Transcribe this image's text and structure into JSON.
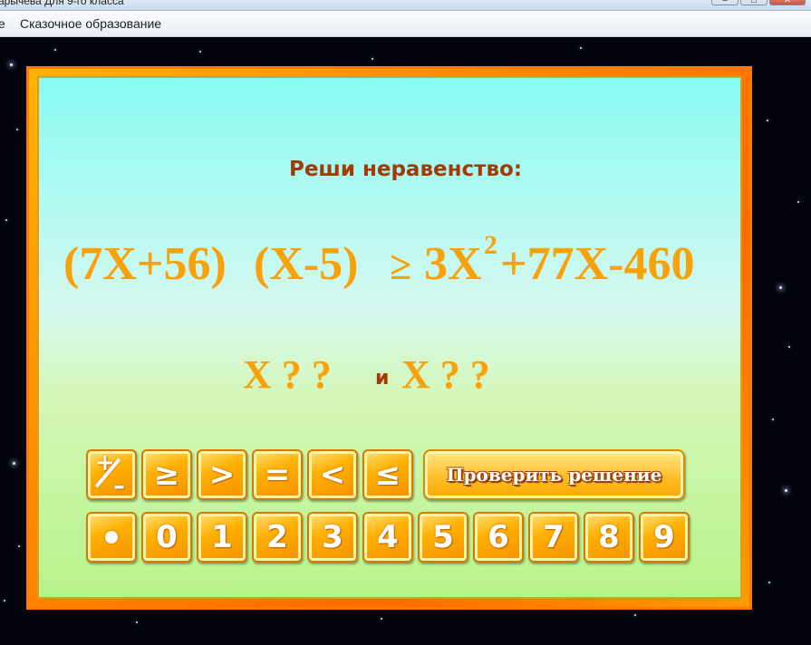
{
  "window": {
    "title": "арычева Для 9-го класса",
    "buttons": {
      "minimize": "–",
      "maximize": "□",
      "close": "✕"
    }
  },
  "menu": {
    "items": [
      "е",
      "Сказочное образование"
    ]
  },
  "slide": {
    "heading": "Реши неравенство:",
    "equation": {
      "lhs1": "(7X+56)",
      "lhs2": "(X-5)",
      "relation": "≥",
      "rhs_term": "3X",
      "exponent": "2",
      "rhs_rest": "+77X-460"
    },
    "answer": {
      "part1": "X ? ?",
      "conjunction": "и",
      "part2": "X ? ?"
    },
    "operators": [
      "≥",
      ">",
      "=",
      "<",
      "≤"
    ],
    "plus_minus_key": {
      "plus": "+",
      "minus": "–"
    },
    "check_button": "Проверить решение",
    "digits": [
      "0",
      "1",
      "2",
      "3",
      "4",
      "5",
      "6",
      "7",
      "8",
      "9"
    ]
  },
  "colors": {
    "frame": "#ff8a00",
    "equation": "#f8a10a",
    "heading": "#a33a05",
    "key": "#ffb000"
  }
}
